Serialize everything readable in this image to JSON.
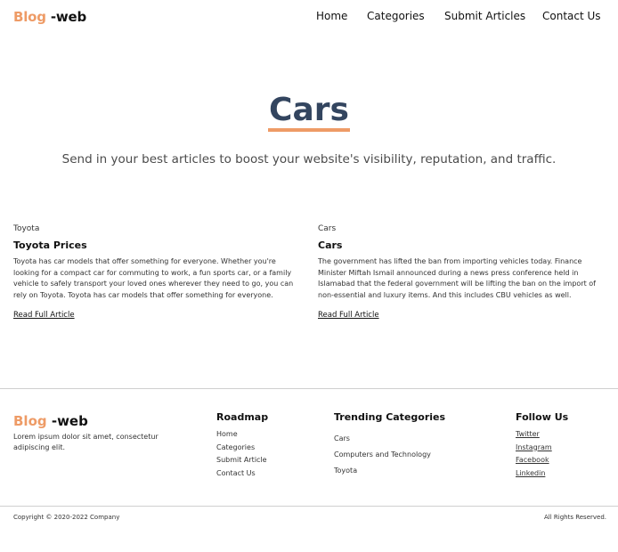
{
  "header": {
    "logo_accent": "Blog",
    "logo_rest": " -web",
    "nav": {
      "home": "Home",
      "categories": "Categories",
      "submit": "Submit Articles",
      "contact": "Contact Us"
    }
  },
  "hero": {
    "title": "Cars",
    "subtitle": "Send in your best articles to boost your website's visibility, reputation, and traffic."
  },
  "articles": [
    {
      "category": "Toyota",
      "title": "Toyota Prices",
      "body": "Toyota has car models that offer something for everyone. Whether you're looking for a compact car for commuting to work, a fun sports car, or a family vehicle to safely transport your loved ones wherever they need to go, you can rely on Toyota. Toyota has car models that offer something for everyone.",
      "link": "Read Full Article"
    },
    {
      "category": "Cars",
      "title": "Cars",
      "body": "The government has lifted the ban from importing vehicles today. Finance Minister Miftah Ismail announced during a news press conference held in Islamabad that the federal government will be lifting the ban on the import of non-essential and luxury items. And this includes CBU vehicles as well.",
      "link": "Read Full Article"
    }
  ],
  "footer": {
    "logo_accent": "Blog",
    "logo_rest": " -web",
    "description": "Lorem ipsum dolor sit amet, consectetur adipiscing elit.",
    "roadmap": {
      "heading": "Roadmap",
      "items": [
        "Home",
        "Categories",
        "Submit Article",
        "Contact Us"
      ]
    },
    "trending": {
      "heading": "Trending Categories",
      "items": [
        "Cars",
        "Computers and Technology",
        "Toyota"
      ]
    },
    "follow": {
      "heading": "Follow Us",
      "items": [
        "Twitter",
        "Instagram",
        "Facebook",
        "Linkedin"
      ]
    },
    "copyright": "Copyright © 2020-2022 Company",
    "rights": "All Rights Reserved."
  },
  "colors": {
    "accent": "#ee9b66",
    "title": "#33455f"
  }
}
